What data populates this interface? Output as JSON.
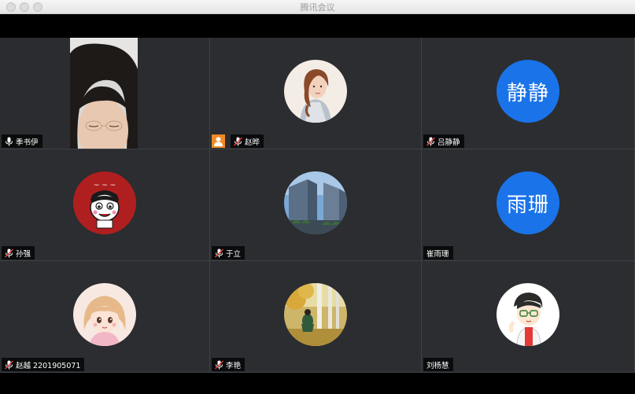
{
  "window": {
    "title": "腾讯会议"
  },
  "participants": [
    {
      "name": "季书伊",
      "type": "video",
      "mic": "on",
      "icon": "camera-feed"
    },
    {
      "name": "赵晔",
      "type": "image",
      "mic": "muted",
      "host": true,
      "icon": "avatar-illustrated-woman"
    },
    {
      "name": "吕静静",
      "type": "text",
      "initials": "静静",
      "mic": "muted",
      "color": "#1a73e8"
    },
    {
      "name": "孙强",
      "type": "image",
      "mic": "muted",
      "icon": "avatar-cartoon-boy-red"
    },
    {
      "name": "于立",
      "type": "image",
      "mic": "muted",
      "icon": "avatar-buildings-sky"
    },
    {
      "name": "崔雨珊",
      "type": "text",
      "initials": "雨珊",
      "mic": "none",
      "color": "#1a73e8"
    },
    {
      "name": "赵越 2201905071",
      "type": "image",
      "mic": "muted",
      "icon": "avatar-anime-girl"
    },
    {
      "name": "李艳",
      "type": "image",
      "mic": "muted",
      "icon": "avatar-autumn-photo"
    },
    {
      "name": "刘杨慧",
      "type": "image",
      "mic": "none",
      "icon": "avatar-cartoon-boy-glasses"
    }
  ],
  "colors": {
    "tile_bg": "#2b2d30",
    "accent": "#1a73e8",
    "host_badge": "#f08a24"
  }
}
